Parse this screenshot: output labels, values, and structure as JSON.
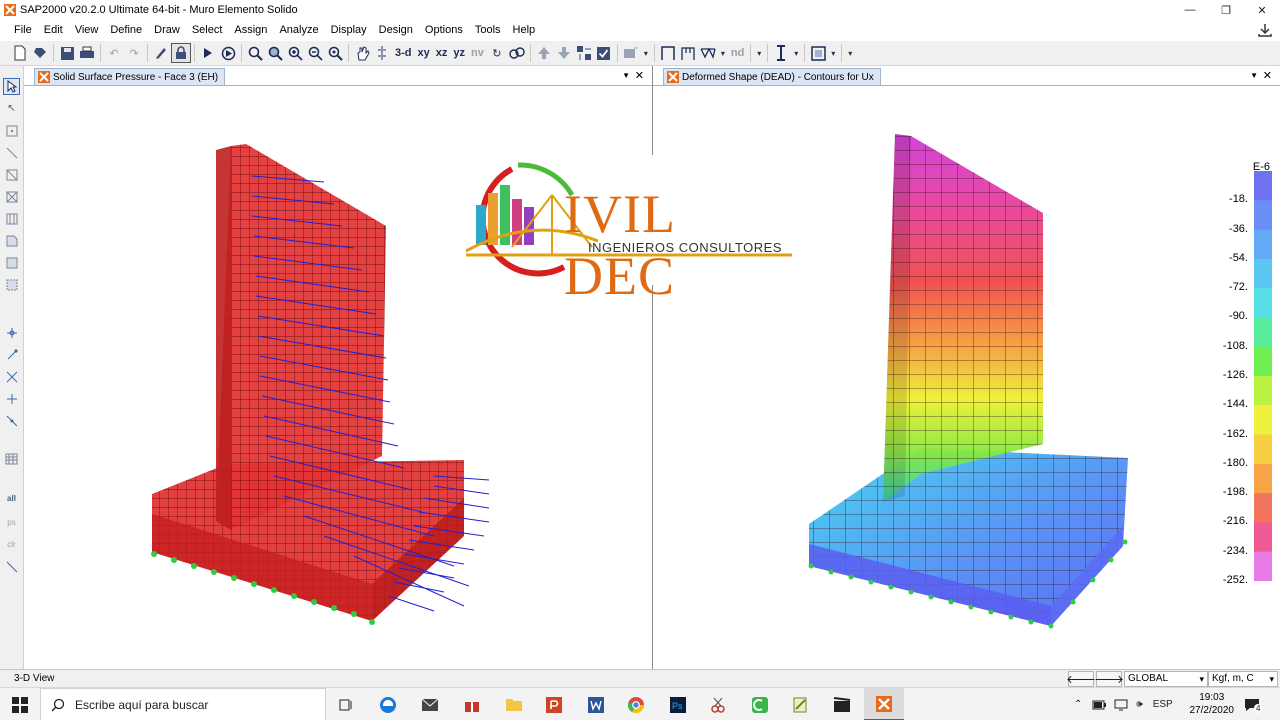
{
  "window": {
    "title": "SAP2000 v20.2.0 Ultimate 64-bit - Muro Elemento Solido",
    "minimize_glyph": "—",
    "restore_glyph": "❐",
    "close_glyph": "✕"
  },
  "menu": {
    "items": [
      "File",
      "Edit",
      "View",
      "Define",
      "Draw",
      "Select",
      "Assign",
      "Analyze",
      "Display",
      "Design",
      "Options",
      "Tools",
      "Help"
    ]
  },
  "toolbar": {
    "view_3d": "3-d",
    "view_xy": "xy",
    "view_xz": "xz",
    "view_yz": "yz",
    "view_nv": "nv",
    "view_nd": "nd",
    "icons": [
      "new-file-icon",
      "open-icon",
      "save-icon",
      "print-icon",
      "undo-icon",
      "redo-icon",
      "edit-pencil-icon",
      "lock-icon",
      "run-analysis-icon",
      "run-live-icon",
      "zoom-window-icon",
      "zoom-rubber-icon",
      "zoom-in-icon",
      "zoom-out-icon",
      "zoom-fit-icon",
      "pan-icon",
      "set-element-icon"
    ]
  },
  "panels": {
    "left": {
      "tab_title": "Solid Surface Pressure - Face 3 (EH)"
    },
    "right": {
      "tab_title": "Deformed Shape (DEAD) - Contours for Ux"
    },
    "panel_menu_glyph": "▼",
    "panel_close_glyph": "✕"
  },
  "legend": {
    "exponent": "E-6",
    "labels": [
      "-18.",
      "-36.",
      "-54.",
      "-72.",
      "-90.",
      "-108.",
      "-126.",
      "-144.",
      "-162.",
      "-180.",
      "-198.",
      "-216.",
      "-234.",
      "-252."
    ],
    "colors": [
      "#6f72f0",
      "#6a8ef6",
      "#62aaf6",
      "#5cc6f3",
      "#58dfe6",
      "#5bed9e",
      "#6fef52",
      "#b9f242",
      "#eef23e",
      "#f6cf43",
      "#f7a449",
      "#f3745c",
      "#f05a92",
      "#e87ce8"
    ]
  },
  "logo": {
    "word": "IVIL DEC",
    "subtitle": "INGENIEROS CONSULTORES"
  },
  "status": {
    "view_label": "3-D View",
    "coord_system": "GLOBAL",
    "units": "Kgf, m, C"
  },
  "taskbar": {
    "search_placeholder": "Escribe aquí para buscar",
    "language": "ESP",
    "time": "19:03",
    "date": "27/2/2020",
    "notifications": "4"
  }
}
